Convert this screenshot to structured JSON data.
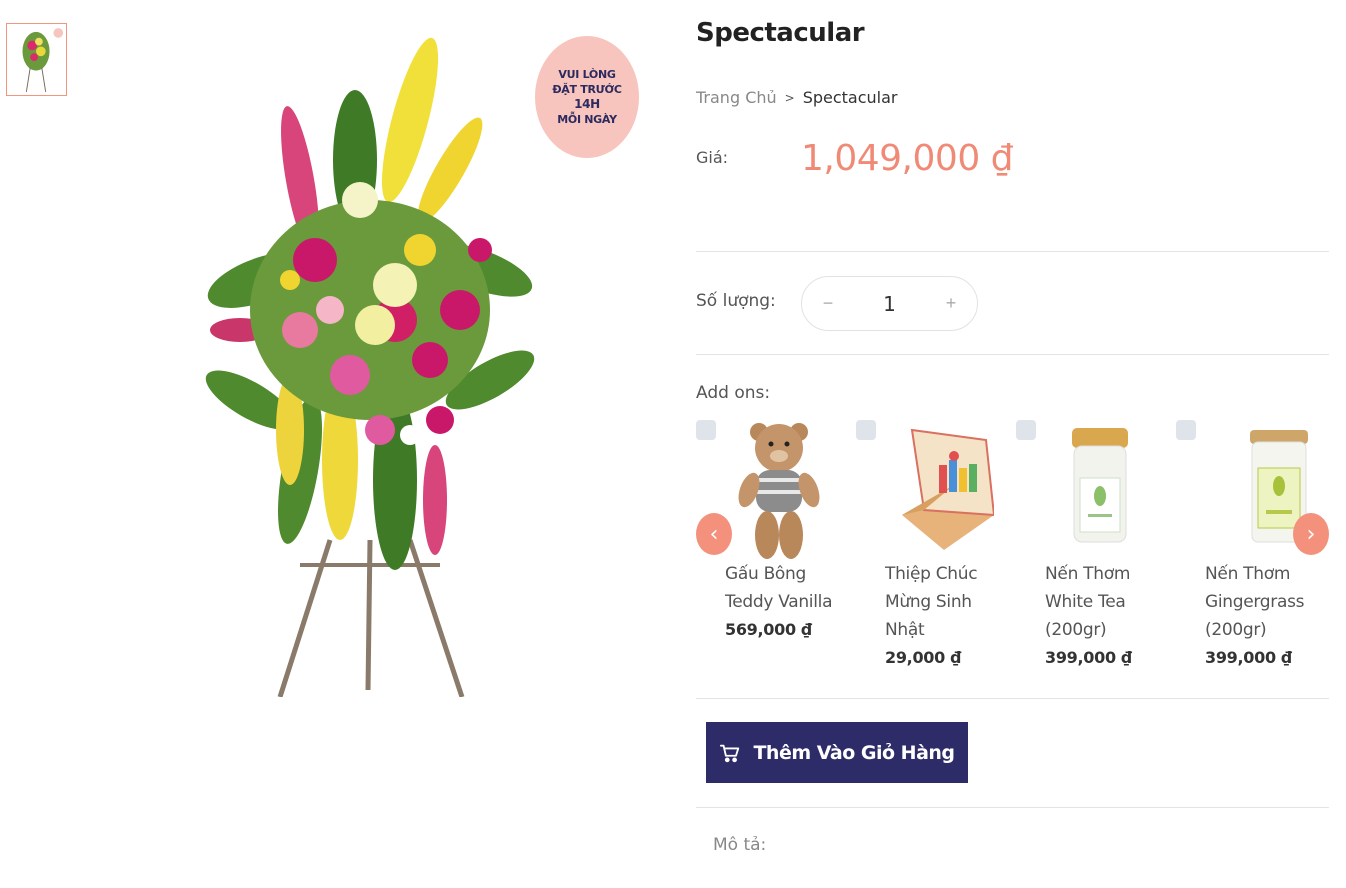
{
  "product": {
    "title": "Spectacular",
    "price_label": "Giá:",
    "price": "1,049,000 ₫",
    "badge": [
      "VUI LÒNG",
      "ĐẶT TRƯỚC",
      "14H",
      "MỖI NGÀY"
    ]
  },
  "breadcrumb": {
    "home": "Trang Chủ",
    "separator": ">",
    "current": "Spectacular"
  },
  "quantity": {
    "label": "Số lượng:",
    "value": "1",
    "minus": "−",
    "plus": "+"
  },
  "addons": {
    "label": "Add ons:",
    "items": [
      {
        "name": "Gấu Bông Teddy Vanilla",
        "price": "569,000 ₫"
      },
      {
        "name": "Thiệp Chúc Mừng Sinh Nhật",
        "price": "29,000 ₫"
      },
      {
        "name": "Nến Thơm White Tea (200gr)",
        "price": "399,000 ₫"
      },
      {
        "name": "Nến Thơm Gingergrass (200gr)",
        "price": "399,000 ₫"
      }
    ],
    "prev": "‹",
    "next": "›"
  },
  "cart": {
    "label": "Thêm Vào Giỏ Hàng"
  },
  "description": {
    "label": "Mô tả:"
  },
  "colors": {
    "accent": "#f08a76",
    "button": "#2d2b68"
  }
}
